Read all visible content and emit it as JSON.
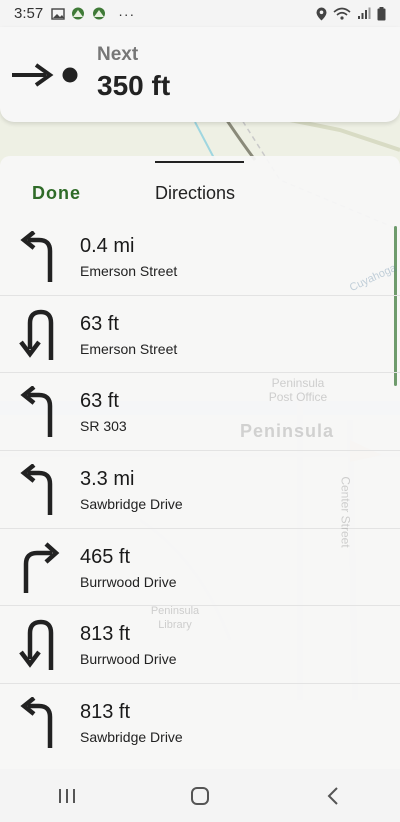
{
  "status_bar": {
    "time": "3:57",
    "more": "···"
  },
  "next_turn": {
    "label": "Next",
    "distance": "350 ft",
    "icon": "arrow-right-to-point-icon"
  },
  "sheet": {
    "done_label": "Done",
    "title": "Directions"
  },
  "steps": [
    {
      "distance": "0.4 mi",
      "street": "Emerson Street",
      "icon": "turn-left-icon"
    },
    {
      "distance": "63 ft",
      "street": "Emerson Street",
      "icon": "u-turn-icon"
    },
    {
      "distance": "63 ft",
      "street": "SR 303",
      "icon": "turn-left-icon"
    },
    {
      "distance": "3.3 mi",
      "street": "Sawbridge Drive",
      "icon": "turn-left-icon"
    },
    {
      "distance": "465 ft",
      "street": "Burrwood Drive",
      "icon": "turn-right-icon"
    },
    {
      "distance": "813 ft",
      "street": "Burrwood Drive",
      "icon": "u-turn-icon"
    },
    {
      "distance": "813 ft",
      "street": "Sawbridge Drive",
      "icon": "turn-left-icon"
    }
  ],
  "map_labels": {
    "place": "Peninsula",
    "post_office": "Peninsula Post Office",
    "library": "Peninsula Library",
    "street": "Center Street",
    "river": "Cuyahoga"
  },
  "colors": {
    "accent": "#2f6b28",
    "scrollbar": "#6e9b6c"
  }
}
